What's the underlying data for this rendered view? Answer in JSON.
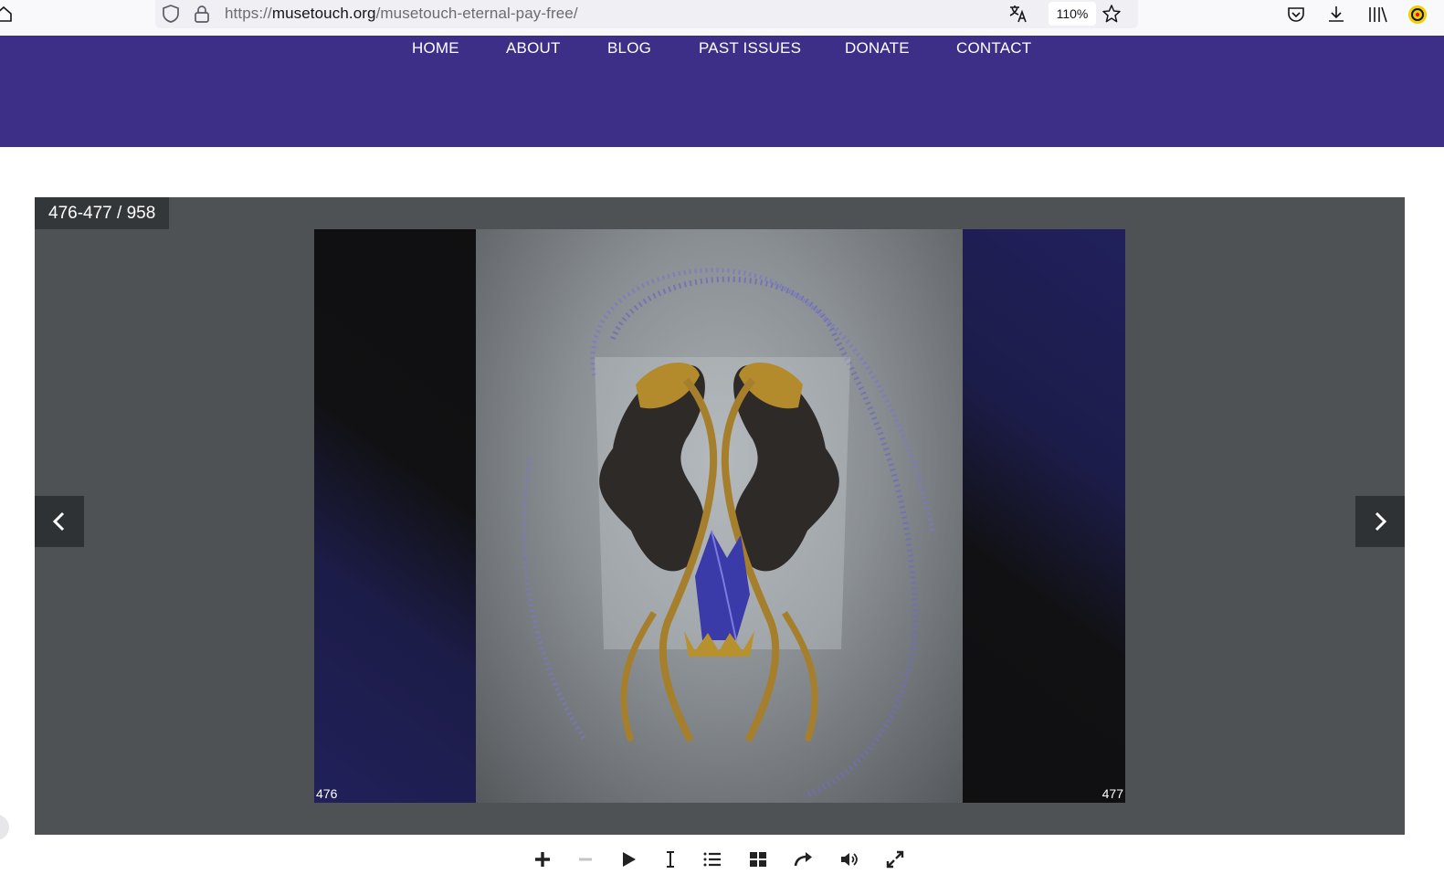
{
  "browser": {
    "url_scheme": "https://",
    "url_domain": "musetouch.org",
    "url_path": "/musetouch-eternal-pay-free/",
    "zoom": "110%",
    "icons": [
      "shield-icon",
      "lock-icon",
      "translate-icon",
      "bookmark-star-icon",
      "pocket-icon",
      "download-icon",
      "library-icon",
      "extension-icon"
    ]
  },
  "nav": {
    "items": [
      {
        "label": "HOME"
      },
      {
        "label": "ABOUT"
      },
      {
        "label": "BLOG"
      },
      {
        "label": "PAST ISSUES"
      },
      {
        "label": "DONATE"
      },
      {
        "label": "CONTACT"
      }
    ]
  },
  "viewer": {
    "counter": "476-477 / 958",
    "left_page_number": "476",
    "right_page_number": "477",
    "toolbar": [
      "zoom-in-icon",
      "zoom-out-icon",
      "play-icon",
      "text-cursor-icon",
      "list-icon",
      "thumbnails-icon",
      "share-icon",
      "sound-icon",
      "fullscreen-icon"
    ]
  },
  "colors": {
    "nav_bg": "#3d2f87",
    "viewer_bg": "#4e5255",
    "counter_bg": "#34373a",
    "arrow_bg": "#2f3234"
  }
}
